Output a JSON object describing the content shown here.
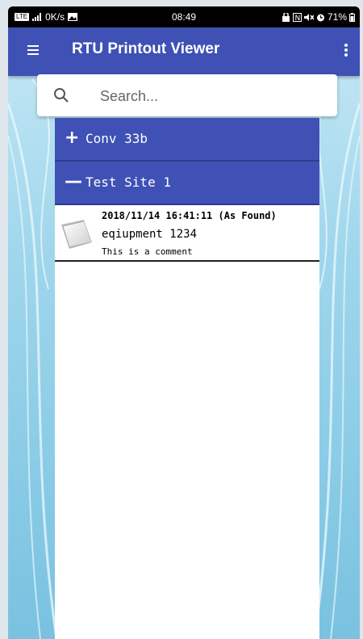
{
  "status_bar": {
    "network": "LTE",
    "speed": "0K/s",
    "time": "08:49",
    "battery": "71%"
  },
  "app_bar": {
    "title": "RTU Printout Viewer",
    "menu_icon": "hamburger-menu-icon",
    "overflow_icon": "more-vertical-icon",
    "color": "#3f51b5"
  },
  "search": {
    "placeholder": "Search...",
    "value": "",
    "icon": "search-icon"
  },
  "groups": [
    {
      "expand_symbol": "+",
      "name": "Conv 33b",
      "expanded": false
    },
    {
      "expand_symbol": "—",
      "name": "Test Site 1",
      "expanded": true
    }
  ],
  "entries": [
    {
      "date": "2018/11/14 16:41:11 (As Found)",
      "equipment": "eqiupment 1234",
      "comment": "This is a comment",
      "icon": "document-icon"
    }
  ]
}
